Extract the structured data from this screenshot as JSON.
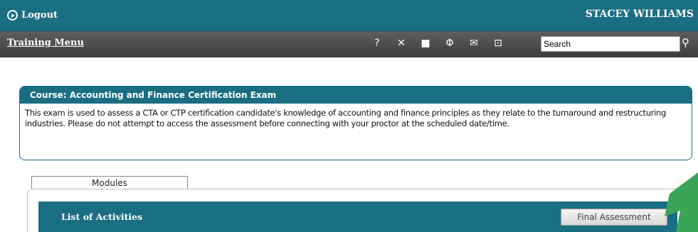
{
  "header": {
    "logout_label": "Logout",
    "user_name": "STACEY WILLIAMS"
  },
  "menubar": {
    "training_menu_label": "Training Menu",
    "icons": [
      "help-icon",
      "tools-icon",
      "notes-icon",
      "split-icon",
      "mail-icon",
      "download-icon"
    ],
    "icon_glyphs": [
      "?",
      "✕",
      "■",
      "Φ",
      "✉",
      "⊡"
    ],
    "search_value": "Search"
  },
  "course": {
    "title": "Course: Accounting and Finance Certification Exam",
    "description": "This exam is used to assess a CTA or CTP certification candidate's knowledge of accounting and finance principles as they relate to the turnaround and restructuring industries. Please do not attempt to access the assessment before connecting with your proctor at the scheduled date/time."
  },
  "tabs": {
    "modules_label": "Modules"
  },
  "activities": {
    "title": "List of Activities",
    "final_assessment_label": "Final Assessment"
  },
  "colors": {
    "teal": "#1a6e82",
    "menu_gray": "#4d4d4d",
    "arrow_green": "#3aa558"
  }
}
